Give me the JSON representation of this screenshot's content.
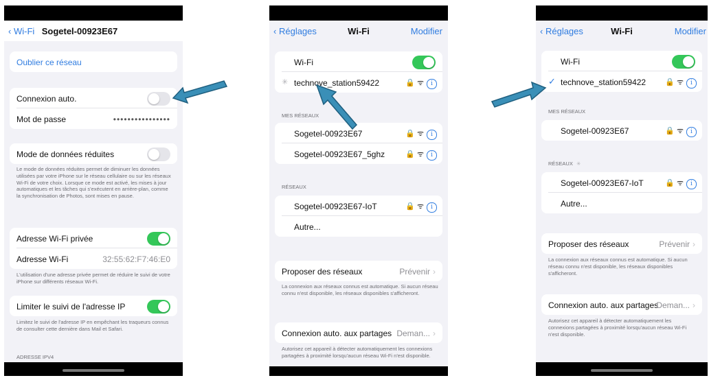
{
  "phone1": {
    "back_label": "Wi-Fi",
    "title": "Sogetel-00923E67",
    "forget_network": "Oublier ce réseau",
    "auto_join": "Connexion auto.",
    "password_label": "Mot de passe",
    "password_value": "••••••••••••••••",
    "low_data_mode": "Mode de données réduites",
    "low_data_desc": "Le mode de données réduites permet de diminuer les données utilisées par votre iPhone sur le réseau cellulaire ou sur les réseaux Wi-Fi de votre choix. Lorsque ce mode est activé, les mises à jour automatiques et les tâches qui s'exécutent en arrière-plan, comme la synchronisation de Photos, sont mises en pause.",
    "private_address": "Adresse Wi-Fi privée",
    "wifi_address_label": "Adresse Wi-Fi",
    "wifi_address_value": "32:55:62:F7:46:E0",
    "private_address_desc": "L'utilisation d'une adresse privée permet de réduire le suivi de votre iPhone sur différents réseaux Wi-Fi.",
    "limit_ip_tracking": "Limiter le suivi de l'adresse IP",
    "limit_ip_desc": "Limitez le suivi de l'adresse IP en empêchant les traqueurs connus de consulter cette dernière dans Mail et Safari.",
    "ipv4_header": "ADRESSE IPV4"
  },
  "phone2": {
    "back_label": "Réglages",
    "title": "Wi-Fi",
    "edit_label": "Modifier",
    "wifi_label": "Wi-Fi",
    "connecting_network": "technove_station59422",
    "my_networks_header": "MES RÉSEAUX",
    "my_networks": [
      "Sogetel-00923E67",
      "Sogetel-00923E67_5ghz"
    ],
    "networks_header": "RÉSEAUX",
    "networks": [
      "Sogetel-00923E67-IoT"
    ],
    "other": "Autre...",
    "ask_join": "Proposer des réseaux",
    "ask_join_value": "Prévenir",
    "ask_join_desc": "La connexion aux réseaux connus est automatique. Si aucun réseau connu n'est disponible, les réseaux disponibles s'afficheront.",
    "auto_hotspot": "Connexion auto. aux partages",
    "auto_hotspot_value": "Deman...",
    "auto_hotspot_desc": "Autorisez cet appareil à détecter automatiquement les connexions partagées à proximité lorsqu'aucun réseau Wi-Fi n'est disponible."
  },
  "phone3": {
    "back_label": "Réglages",
    "title": "Wi-Fi",
    "edit_label": "Modifier",
    "wifi_label": "Wi-Fi",
    "connected_network": "technove_station59422",
    "my_networks_header": "MES RÉSEAUX",
    "my_networks": [
      "Sogetel-00923E67"
    ],
    "networks_header": "RÉSEAUX",
    "networks": [
      "Sogetel-00923E67-IoT"
    ],
    "other": "Autre...",
    "ask_join": "Proposer des réseaux",
    "ask_join_value": "Prévenir",
    "ask_join_desc": "La connexion aux réseaux connus est automatique. Si aucun réseau connu n'est disponible, les réseaux disponibles s'afficheront.",
    "auto_hotspot": "Connexion auto. aux partages",
    "auto_hotspot_value": "Deman...",
    "auto_hotspot_desc": "Autorisez cet appareil à détecter automatiquement les connexions partagées à proximité lorsqu'aucun réseau Wi-Fi n'est disponible."
  },
  "icons": {
    "lock": "🔒",
    "wifi": "ᯤ",
    "info": "i",
    "check": "✓",
    "chevron": "›",
    "spinner": "✳",
    "back": "‹"
  },
  "colors": {
    "accent": "#2f7ce0",
    "toggle_on": "#34c759",
    "arrow": "#3a8fb7"
  }
}
